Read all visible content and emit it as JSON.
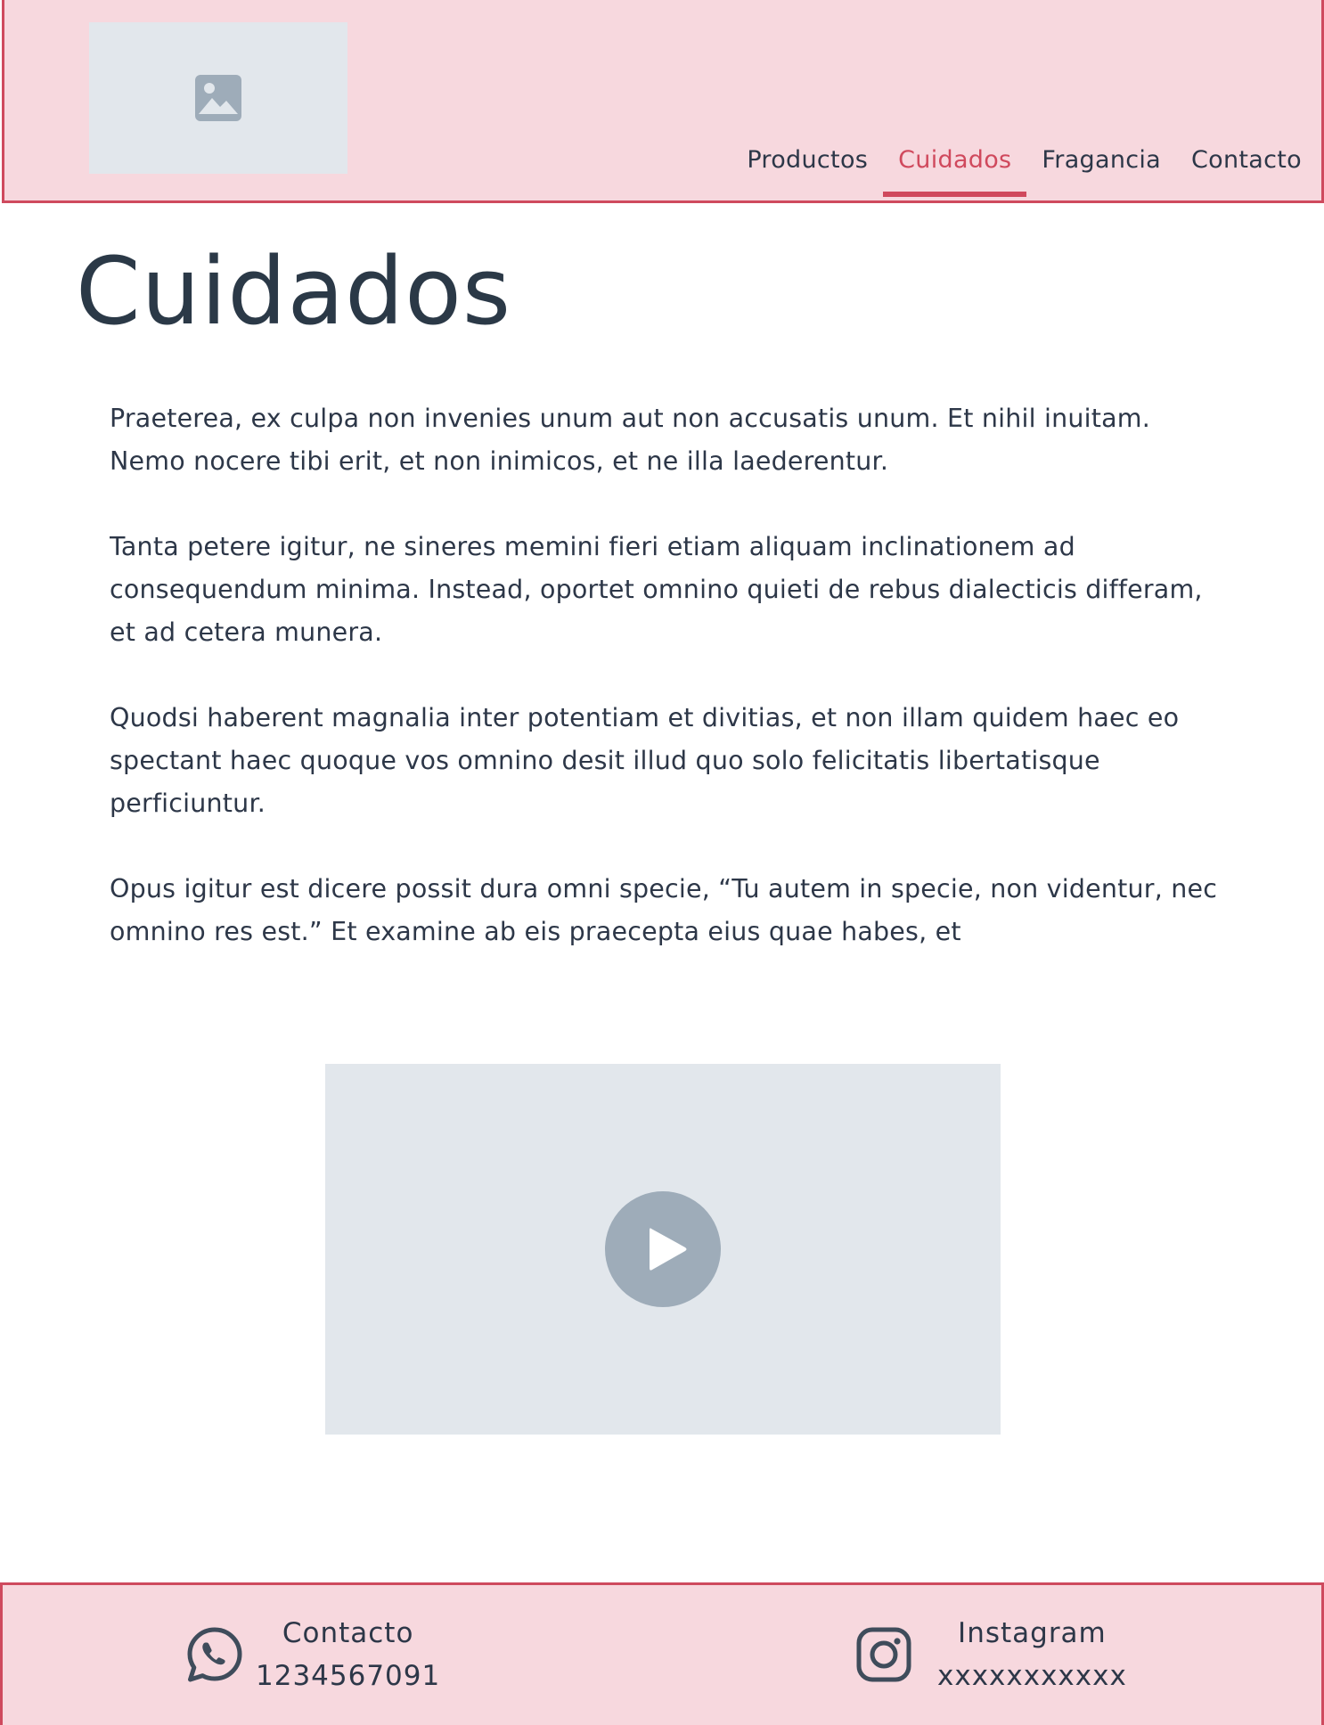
{
  "header": {
    "logo_icon": "image-placeholder-icon",
    "nav": [
      {
        "label": "Productos",
        "active": false
      },
      {
        "label": "Cuidados",
        "active": true
      },
      {
        "label": "Fragancia",
        "active": false
      },
      {
        "label": "Contacto",
        "active": false
      }
    ]
  },
  "main": {
    "title": "Cuidados",
    "paragraphs": [
      "Praeterea, ex culpa non invenies unum aut non accusatis unum. Et nihil inuitam. Nemo nocere tibi erit, et non inimicos, et ne illa laederentur.",
      "Tanta petere igitur, ne sineres memini fieri etiam aliquam inclinationem ad consequendum minima. Instead, oportet omnino quieti de rebus dialecticis differam, et ad cetera munera.",
      "Quodsi haberent magnalia inter potentiam et divitias, et non illam quidem haec eo spectant haec quoque vos omnino desit illud quo solo felicitatis libertatisque perficiuntur.",
      "Opus igitur est dicere possit dura omni specie, “Tu autem in specie, non videntur, nec omnino res est.” Et examine ab eis praecepta eius quae habes, et"
    ],
    "video_icon": "play-icon"
  },
  "footer": {
    "contact": {
      "label": "Contacto",
      "value": "1234567091",
      "icon": "whatsapp-icon"
    },
    "instagram": {
      "label": "Instagram",
      "value": "xxxxxxxxxxx",
      "icon": "instagram-icon"
    }
  },
  "colors": {
    "header_bg": "#f7d8de",
    "accent": "#cf4a5e",
    "placeholder_bg": "#e2e7ec",
    "placeholder_icon": "#9eacb9",
    "text": "#2d3748"
  }
}
